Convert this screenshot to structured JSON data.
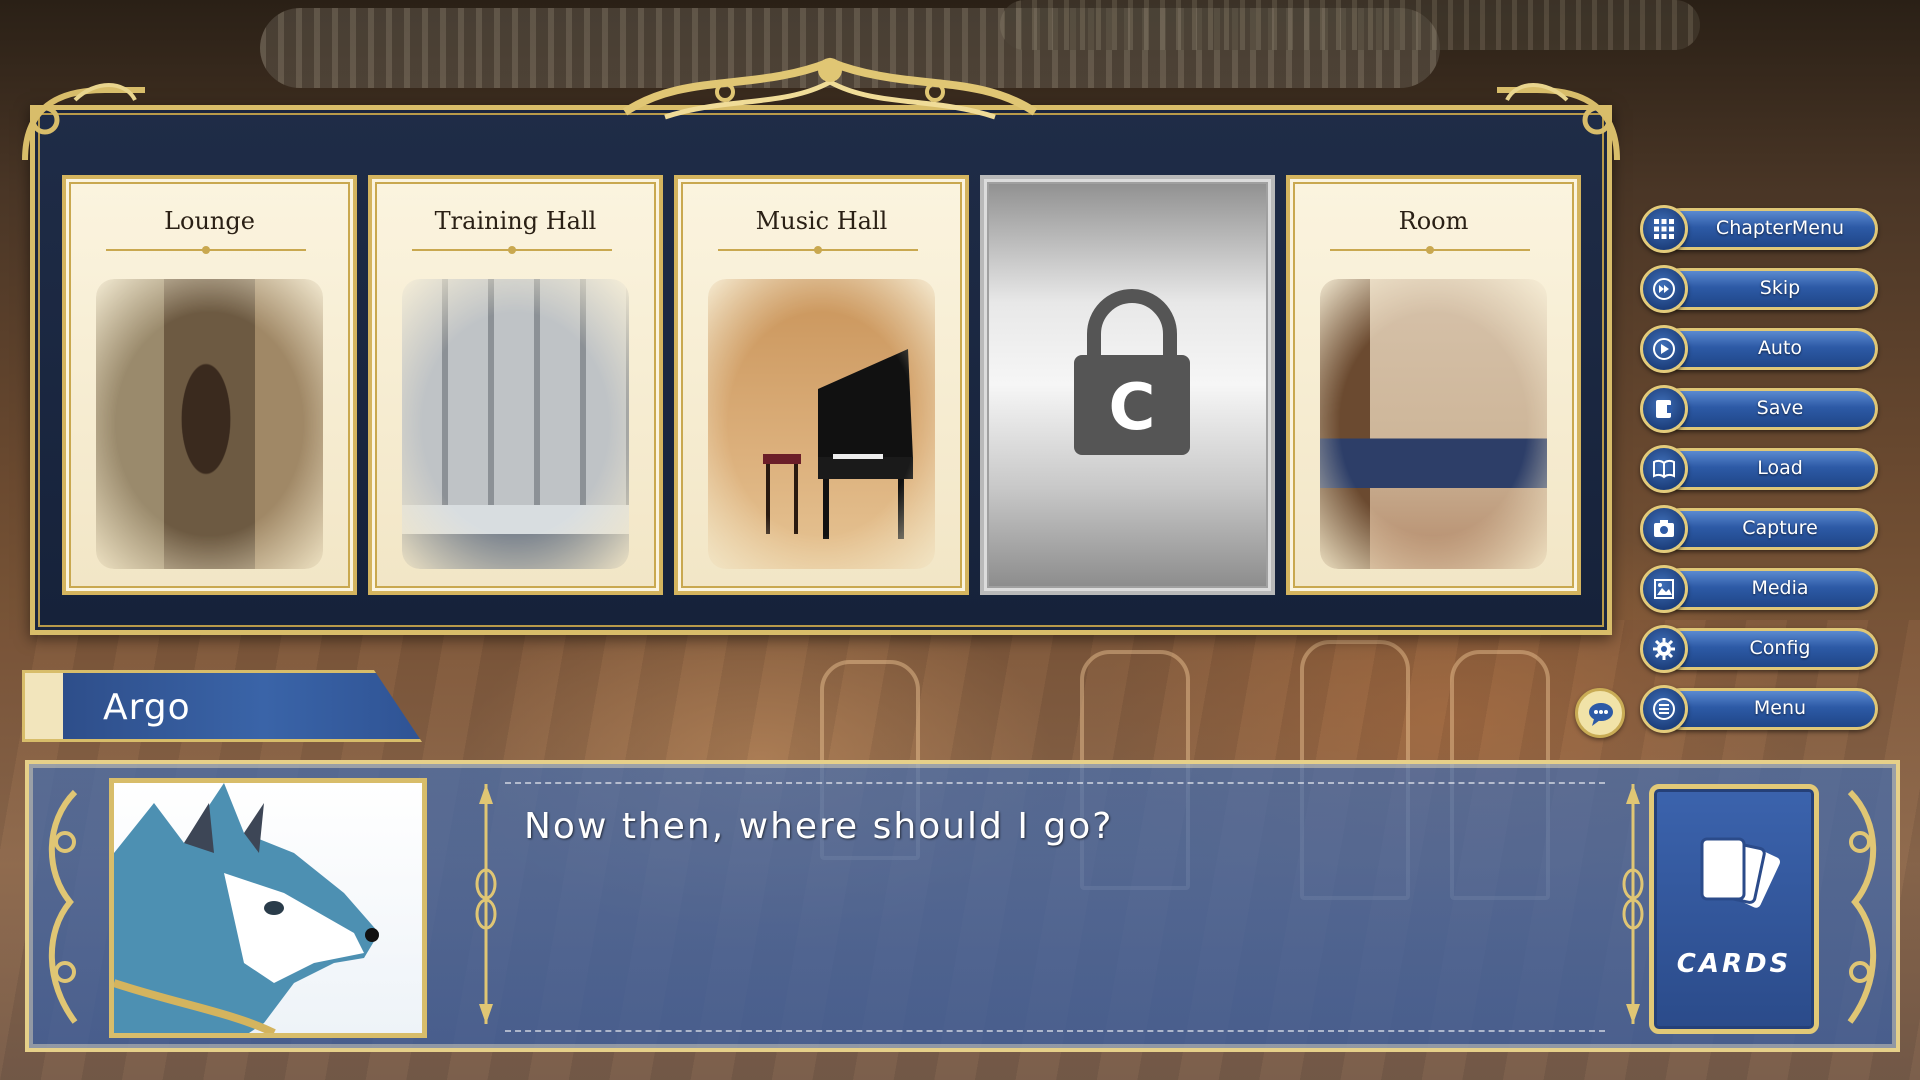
{
  "locations": [
    {
      "label": "Lounge",
      "locked": false
    },
    {
      "label": "Training Hall",
      "locked": false
    },
    {
      "label": "Music Hall",
      "locked": false
    },
    {
      "label": "",
      "locked": true,
      "lock_letter": "C"
    },
    {
      "label": "Room",
      "locked": false
    }
  ],
  "dialog": {
    "speaker": "Argo",
    "text": "Now then, where should I go?",
    "cards_label": "CARDS"
  },
  "menu": {
    "items": [
      {
        "label": "ChapterMenu",
        "icon": "grid-icon"
      },
      {
        "label": "Skip",
        "icon": "fast-forward-icon"
      },
      {
        "label": "Auto",
        "icon": "play-icon"
      },
      {
        "label": "Save",
        "icon": "save-book-icon"
      },
      {
        "label": "Load",
        "icon": "open-book-icon"
      },
      {
        "label": "Capture",
        "icon": "camera-icon"
      },
      {
        "label": "Media",
        "icon": "image-gallery-icon"
      },
      {
        "label": "Config",
        "icon": "gear-icon"
      },
      {
        "label": "Menu",
        "icon": "hamburger-icon"
      }
    ]
  },
  "colors": {
    "gold": "#d8bd6a",
    "panel_navy": "#1f2c47",
    "button_blue": "#2d5aa6",
    "dialog_blue": "#466eaf"
  }
}
